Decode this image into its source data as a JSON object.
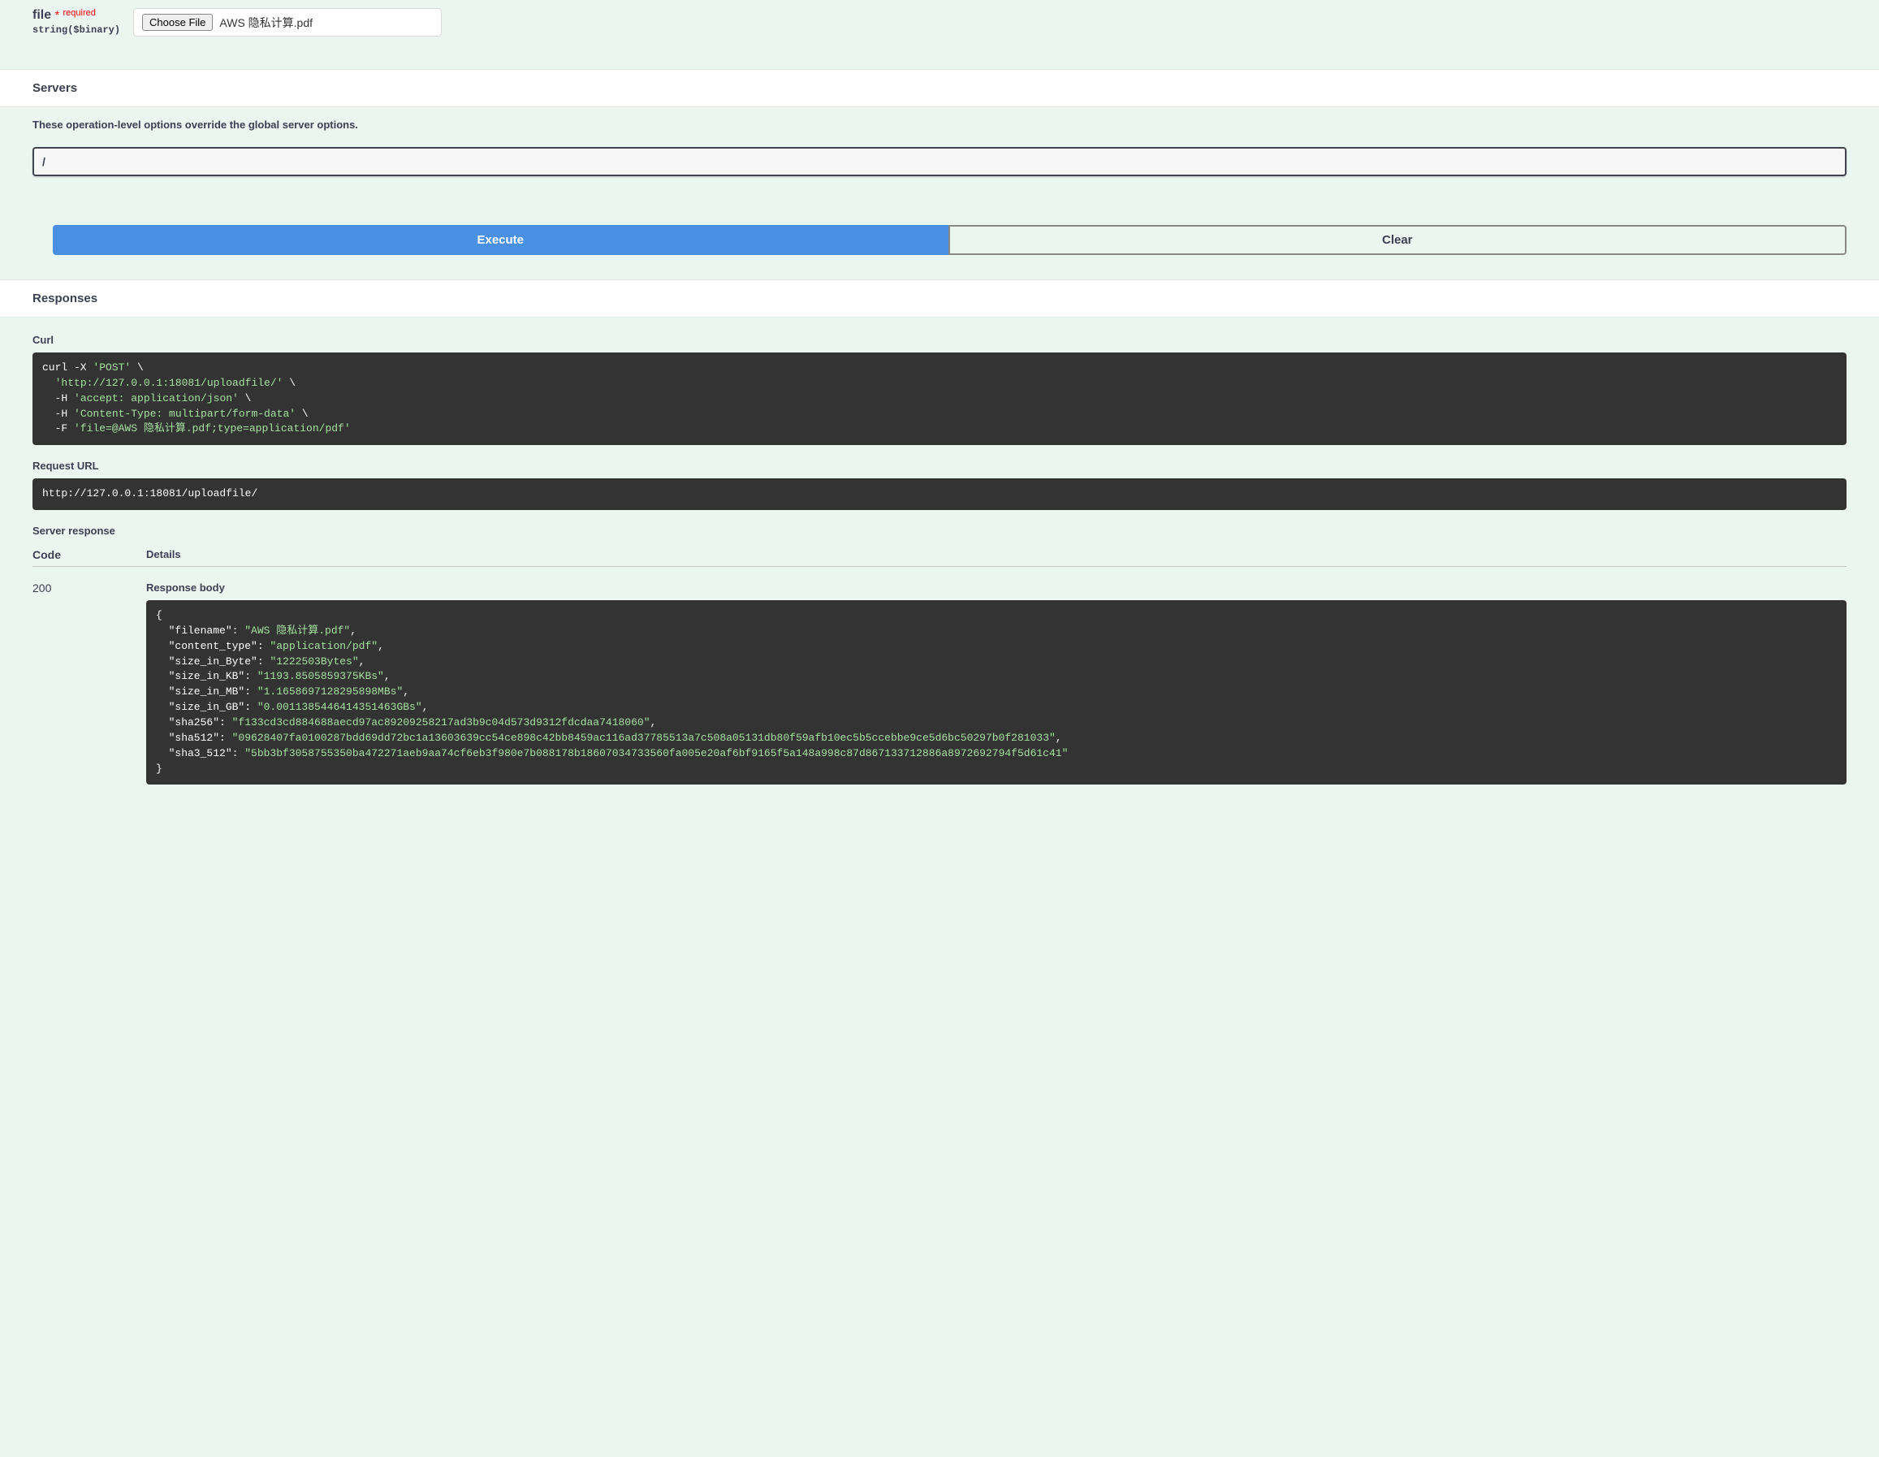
{
  "param": {
    "name": "file",
    "required_label": "required",
    "type_label": "string($binary)",
    "choose_file_btn": "Choose File",
    "chosen_file_name": "AWS 隐私计算.pdf"
  },
  "servers": {
    "header": "Servers",
    "note": "These operation-level options override the global server options.",
    "selected": "/"
  },
  "buttons": {
    "execute": "Execute",
    "clear": "Clear"
  },
  "responses": {
    "header": "Responses",
    "curl_label": "Curl",
    "curl_code": "curl -X 'POST' \\\n  'http://127.0.0.1:18081/uploadfile/' \\\n  -H 'accept: application/json' \\\n  -H 'Content-Type: multipart/form-data' \\\n  -F 'file=@AWS 隐私计算.pdf;type=application/pdf'",
    "request_url_label": "Request URL",
    "request_url": "http://127.0.0.1:18081/uploadfile/",
    "server_response_label": "Server response",
    "col_code": "Code",
    "col_details": "Details",
    "status_code": "200",
    "response_body_label": "Response body",
    "response_body": "{\n  \"filename\": \"AWS 隐私计算.pdf\",\n  \"content_type\": \"application/pdf\",\n  \"size_in_Byte\": \"1222503Bytes\",\n  \"size_in_KB\": \"1193.8505859375KBs\",\n  \"size_in_MB\": \"1.1658697128295898MBs\",\n  \"size_in_GB\": \"0.0011385446414351463GBs\",\n  \"sha256\": \"f133cd3cd884688aecd97ac89209258217ad3b9c04d573d9312fdcdaa7418060\",\n  \"sha512\": \"09628407fa0100287bdd69dd72bc1a13603639cc54ce898c42bb8459ac116ad37785513a7c508a05131db80f59afb10ec5b5ccebbe9ce5d6bc50297b0f281033\",\n  \"sha3_512\": \"5bb3bf3058755350ba472271aeb9aa74cf6eb3f980e7b088178b18607034733560fa005e20af6bf9165f5a148a998c87d867133712886a8972692794f5d61c41\"\n}"
  }
}
